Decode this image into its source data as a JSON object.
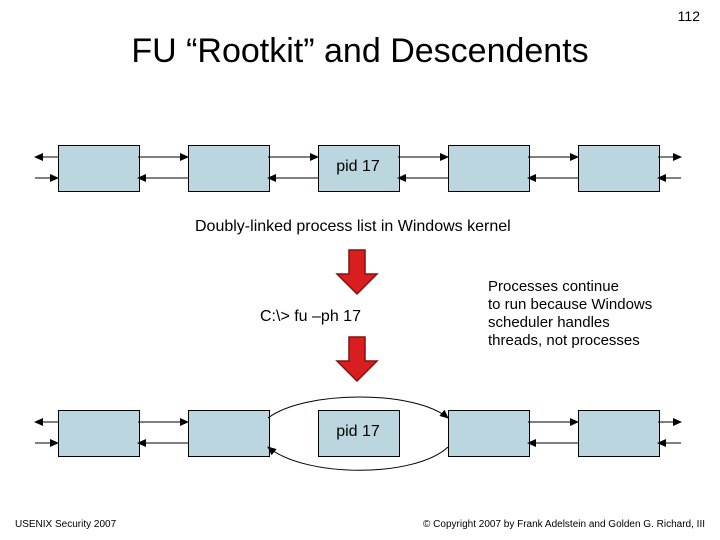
{
  "page_number": "112",
  "title": "FU “Rootkit” and Descendents",
  "top_list": {
    "pid_label": "pid 17",
    "caption": "Doubly-linked process list in Windows kernel"
  },
  "command": "C:\\> fu –ph 17",
  "note": "Processes continue\nto run because Windows\nscheduler handles\nthreads, not processes",
  "bottom_list": {
    "pid_label": "pid 17"
  },
  "footer_left": "USENIX Security 2007",
  "footer_right": "© Copyright 2007 by Frank Adelstein and Golden G. Richard, III",
  "colors": {
    "box_fill": "#bcd6df",
    "arrow_red_fill": "#d81e1e",
    "arrow_red_stroke": "#8a0f0f"
  }
}
